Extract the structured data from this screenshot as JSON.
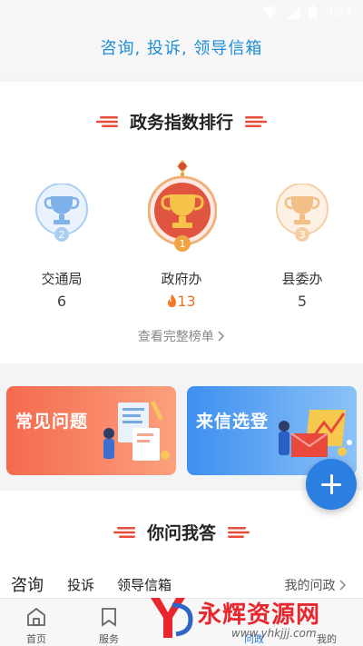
{
  "status_bar": {
    "time": "9:24"
  },
  "header": {
    "title": "咨询, 投诉, 领导信箱"
  },
  "ranking": {
    "title": "政务指数排行",
    "items": [
      {
        "rank": "2",
        "name": "交通局",
        "score": "6"
      },
      {
        "rank": "1",
        "name": "政府办",
        "score": "13"
      },
      {
        "rank": "3",
        "name": "县委办",
        "score": "5"
      }
    ],
    "view_all": "查看完整榜单"
  },
  "cards": {
    "faq": "常见问题",
    "letter": "来信选登"
  },
  "qa": {
    "title": "你问我答",
    "tabs": [
      "咨询",
      "投诉",
      "领导信箱"
    ],
    "my_link": "我的问政"
  },
  "nav": {
    "items": [
      "首页",
      "服务",
      "问政",
      "我的"
    ]
  },
  "watermark": {
    "name": "永辉资源网",
    "url": "www.yhkjjj.com"
  },
  "colors": {
    "accent_blue": "#1f8dd6",
    "heading_red": "#e84c3d",
    "faq_orange": "#f56a4f",
    "letter_blue": "#3d8ff0",
    "watermark_red": "#e8262d"
  }
}
